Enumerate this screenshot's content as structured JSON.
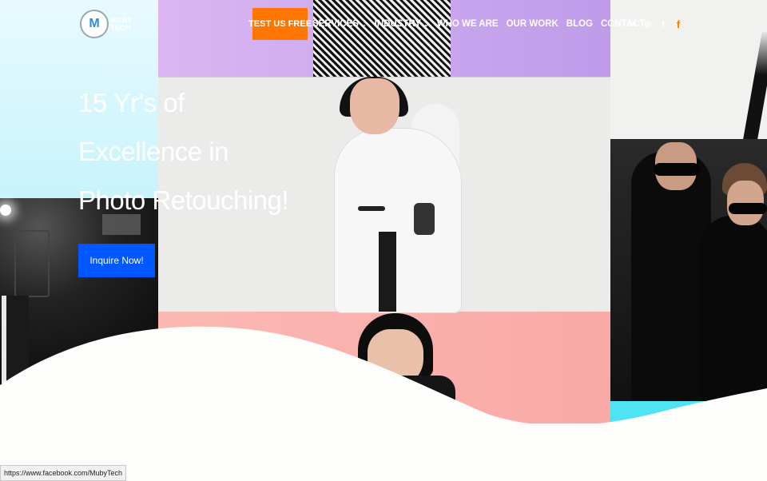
{
  "logo": {
    "mark": "M",
    "text_line1": "MUBY",
    "text_line2": "TECH"
  },
  "header": {
    "cta_label": "TEST US FREE",
    "nav": [
      {
        "label": "SERVICES",
        "has_dropdown": true
      },
      {
        "label": "INDUSTRY",
        "has_dropdown": true
      },
      {
        "label": "WHO WE ARE",
        "has_dropdown": false
      },
      {
        "label": "OUR WORK",
        "has_dropdown": false
      },
      {
        "label": "BLOG",
        "has_dropdown": false
      },
      {
        "label": "CONTACT",
        "has_dropdown": false
      }
    ],
    "chevron": "⌄",
    "social": [
      {
        "icon": "linkedin-icon",
        "glyph": "in"
      },
      {
        "icon": "instagram-icon",
        "glyph": "◎"
      },
      {
        "icon": "twitter-icon",
        "glyph": "t"
      },
      {
        "icon": "facebook-icon",
        "glyph": "f"
      }
    ]
  },
  "hero": {
    "line1": "15 Yr's of",
    "line2": "Excellence in",
    "line3": "Photo Retouching!",
    "button": "Inquire Now!"
  },
  "status": {
    "url": "https://www.facebook.com/MubyTech"
  },
  "colors": {
    "cta": "#ff7700",
    "button": "#0057ff",
    "facebook_icon": "#ff7700"
  }
}
